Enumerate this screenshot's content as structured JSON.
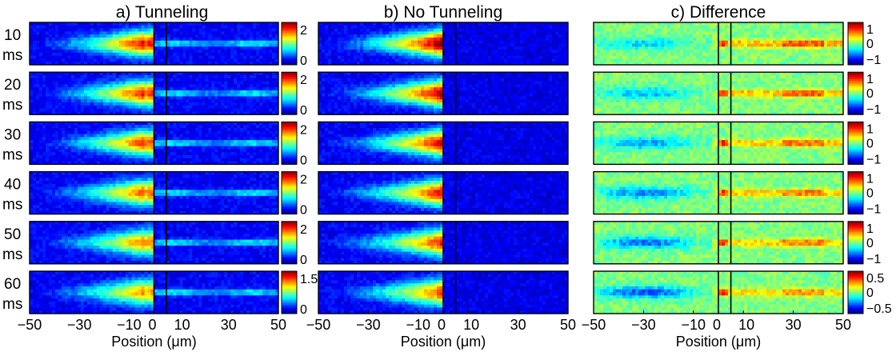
{
  "figure": {
    "panels": [
      {
        "title": "a)  Tunneling",
        "kind": "tunneling"
      },
      {
        "title": "b)  No Tunneling",
        "kind": "notunnel"
      },
      {
        "title": "c)  Difference",
        "kind": "difference"
      }
    ],
    "rows": [
      {
        "time": "10",
        "unit": "ms"
      },
      {
        "time": "20",
        "unit": "ms"
      },
      {
        "time": "30",
        "unit": "ms"
      },
      {
        "time": "40",
        "unit": "ms"
      },
      {
        "time": "50",
        "unit": "ms"
      },
      {
        "time": "60",
        "unit": "ms"
      }
    ],
    "xlabel": "Position (μm)",
    "xticks": [
      "−50",
      "−30",
      "−10",
      "0",
      "10",
      "30",
      "50"
    ],
    "colorbars": {
      "tunneling": [
        {
          "top": "2",
          "bottom": "0"
        },
        {
          "top": "2",
          "bottom": "0"
        },
        {
          "top": "2",
          "bottom": "0"
        },
        {
          "top": "2",
          "bottom": "0"
        },
        {
          "top": "2",
          "bottom": "0"
        },
        {
          "top": "1.5",
          "bottom": "0"
        }
      ],
      "difference": [
        {
          "top": "1",
          "mid": "0",
          "bottom": "−1"
        },
        {
          "top": "1",
          "mid": "0",
          "bottom": "−1"
        },
        {
          "top": "1",
          "mid": "0",
          "bottom": "−1"
        },
        {
          "top": "1",
          "mid": "0",
          "bottom": "−1"
        },
        {
          "top": "1",
          "mid": "0",
          "bottom": "−1"
        },
        {
          "top": "0.5",
          "mid": "0",
          "bottom": "−0.5"
        }
      ]
    },
    "colormap": "jet",
    "barrier_lines_um": [
      0,
      5
    ]
  },
  "chart_data": {
    "type": "heatmap",
    "colormap": "jet",
    "xlabel": "Position (μm)",
    "xlim": [
      -50,
      50
    ],
    "xtick_values": [
      -50,
      -30,
      -10,
      0,
      10,
      30,
      50
    ],
    "times_ms": [
      10,
      20,
      30,
      40,
      50,
      60
    ],
    "panels": [
      {
        "title": "a)  Tunneling",
        "colorbar_ranges": [
          [
            0,
            2
          ],
          [
            0,
            2
          ],
          [
            0,
            2
          ],
          [
            0,
            2
          ],
          [
            0,
            2
          ],
          [
            0,
            1.5
          ]
        ]
      },
      {
        "title": "b)  No Tunneling"
      },
      {
        "title": "c)  Difference",
        "colorbar_ranges": [
          [
            -1,
            1
          ],
          [
            -1,
            1
          ],
          [
            -1,
            1
          ],
          [
            -1,
            1
          ],
          [
            -1,
            1
          ],
          [
            -0.5,
            0.5
          ]
        ]
      }
    ]
  }
}
